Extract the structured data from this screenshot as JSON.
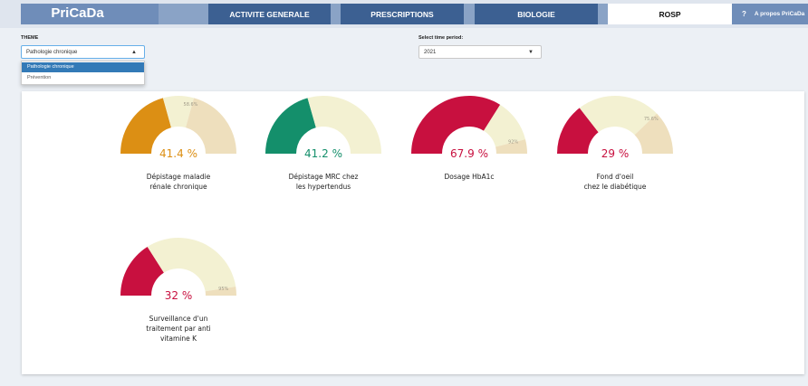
{
  "header": {
    "brand": "PriCaDa",
    "menu_icon": "☰",
    "tabs": [
      {
        "label": "ACTIVITE GENERALE",
        "active": false
      },
      {
        "label": "PRESCRIPTIONS",
        "active": false
      },
      {
        "label": "BIOLOGIE",
        "active": false
      },
      {
        "label": "ROSP",
        "active": true
      }
    ],
    "about": {
      "icon": "?",
      "label": "A propos PriCaDa"
    }
  },
  "theme": {
    "label": "THEME",
    "value": "Pathologie chronique",
    "options": [
      "Pathologie chronique",
      "Prévention"
    ]
  },
  "period": {
    "label": "Select time period:",
    "value": "2021"
  },
  "gauges": [
    {
      "title_lines": [
        "Dépistage maladie",
        "rénale chronique"
      ],
      "value": 41.4,
      "value_label": "41.4 %",
      "target": 58.6,
      "target_label": "58.6%",
      "color": "#dc8f14"
    },
    {
      "title_lines": [
        "Dépistage MRC chez",
        "les hypertendus"
      ],
      "value": 41.2,
      "value_label": "41.2 %",
      "target": null,
      "target_label": "",
      "color": "#148f6b"
    },
    {
      "title_lines": [
        "Dosage HbA1c"
      ],
      "value": 67.9,
      "value_label": "67.9 %",
      "target": 92,
      "target_label": "92%",
      "color": "#c8103f"
    },
    {
      "title_lines": [
        "Fond d'oeil",
        "chez le diabétique"
      ],
      "value": 29,
      "value_label": "29 %",
      "target": 75.6,
      "target_label": "75.6%",
      "color": "#c8103f"
    },
    {
      "title_lines": [
        "Surveillance d'un",
        "traitement par anti",
        "vitamine K"
      ],
      "value": 32,
      "value_label": "32 %",
      "target": 95,
      "target_label": "95%",
      "color": "#c8103f"
    }
  ],
  "colors": {
    "track": "#f3f1d2",
    "target_band": "#eedfbd",
    "nav": "#3c6092",
    "brand_bg": "#6f8db9"
  }
}
